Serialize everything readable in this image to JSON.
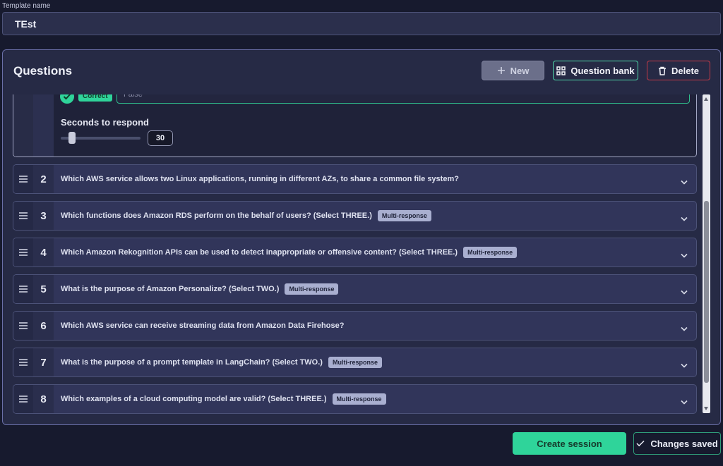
{
  "template": {
    "label": "Template name",
    "value": "TEst"
  },
  "questions_panel": {
    "title": "Questions",
    "buttons": {
      "new": "New",
      "question_bank": "Question bank",
      "delete": "Delete"
    },
    "expanded_question": {
      "correct_badge": "Correct",
      "answer_text": "False",
      "seconds_label": "Seconds to respond",
      "seconds_value": "30",
      "seconds_slider_level": 0.1
    },
    "items": [
      {
        "number": "2",
        "text": "Which AWS service allows two Linux applications, running in different AZs, to share a common file system?",
        "badge": ""
      },
      {
        "number": "3",
        "text": "Which functions does Amazon RDS perform on the behalf of users? (Select THREE.)",
        "badge": "Multi-response"
      },
      {
        "number": "4",
        "text": "Which Amazon Rekognition APIs can be used to detect inappropriate or offensive content? (Select THREE.)",
        "badge": "Multi-response"
      },
      {
        "number": "5",
        "text": "What is the purpose of Amazon Personalize? (Select TWO.)",
        "badge": "Multi-response"
      },
      {
        "number": "6",
        "text": "Which AWS service can receive streaming data from Amazon Data Firehose?",
        "badge": ""
      },
      {
        "number": "7",
        "text": "What is the purpose of a prompt template in LangChain? (Select TWO.)",
        "badge": "Multi-response"
      },
      {
        "number": "8",
        "text": "Which examples of a cloud computing model are valid? (Select THREE.)",
        "badge": "Multi-response"
      }
    ]
  },
  "footer": {
    "create_session": "Create session",
    "changes_saved": "Changes saved"
  },
  "colors": {
    "accent_green": "#2fd49a",
    "danger_red": "#c43a47",
    "background": "#171a2e"
  }
}
